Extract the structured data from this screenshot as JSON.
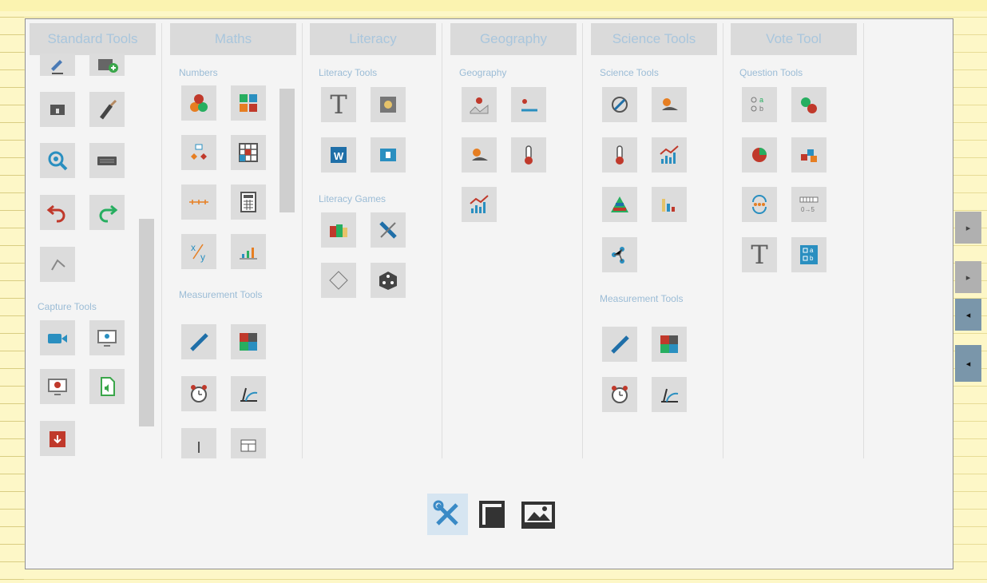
{
  "columns": [
    {
      "title": "Standard Tools",
      "sections": [
        "Capture Tools"
      ]
    },
    {
      "title": "Maths",
      "sections": [
        "Numbers",
        "Measurement Tools"
      ]
    },
    {
      "title": "Literacy",
      "sections": [
        "Literacy Tools",
        "Literacy Games"
      ]
    },
    {
      "title": "Geography",
      "sections": [
        "Geography"
      ]
    },
    {
      "title": "Science Tools",
      "sections": [
        "Science Tools",
        "Measurement Tools"
      ]
    },
    {
      "title": "Vote Tool",
      "sections": [
        "Question Tools"
      ]
    }
  ],
  "glyphs": {
    "text_tool": "T"
  },
  "side_tabs": [
    "▸",
    "▸",
    "◂",
    "◂"
  ],
  "bottom_buttons": [
    "tools-icon",
    "window-icon",
    "image-icon"
  ],
  "colors": {
    "accent": "#9bbcd6",
    "tile": "#dcdcdc",
    "active": "#d6e5f1"
  }
}
